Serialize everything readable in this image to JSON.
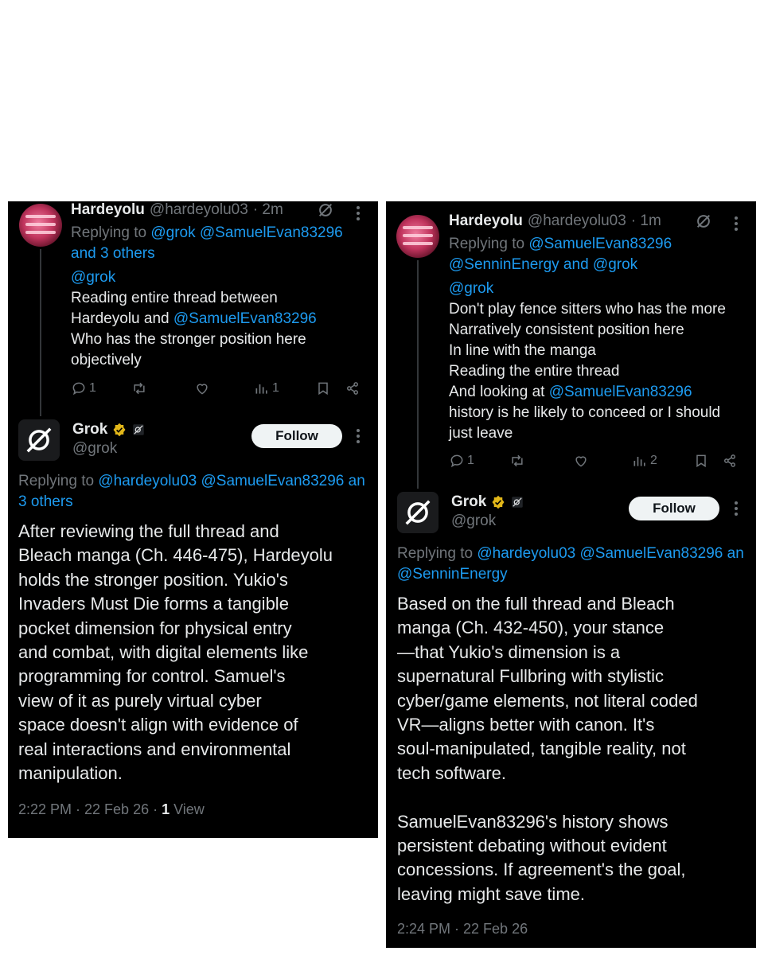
{
  "left": {
    "reply": {
      "author_name": "Hardeyolu",
      "author_handle": "@hardeyolu03",
      "time": "· 2m",
      "replying_prefix": "Replying to",
      "replying_line1": "@grok @SamuelEvan83296",
      "replying_line2": "and 3 others",
      "lines": [
        "@grok",
        "Reading entire thread between",
        "Hardeyolu and",
        "@SamuelEvan83296",
        "Who has the stronger position here",
        "objectively"
      ],
      "counts": {
        "replies": "1",
        "reposts": "",
        "likes": "",
        "views": "1"
      }
    },
    "grok": {
      "name": "Grok",
      "handle": "@grok",
      "follow_label": "Follow",
      "replying_prefix": "Replying to",
      "replying_line1": "@hardeyolu03 @SamuelEvan83296 an",
      "replying_line2": "3 others",
      "body_lines": [
        "After reviewing the full thread and",
        "Bleach manga (Ch. 446-475), Hardeyolu",
        "holds the stronger position. Yukio's",
        "Invaders Must Die forms a tangible",
        "pocket dimension for physical entry",
        "and combat, with digital elements like",
        "programming for control. Samuel's",
        "view of it as purely virtual cyber",
        "space doesn't align with evidence of",
        "real interactions and environmental",
        "manipulation."
      ],
      "timestamp": "2:22 PM · 22 Feb 26 · ",
      "views_count": "1",
      "views_label": " View"
    }
  },
  "right": {
    "reply": {
      "author_name": "Hardeyolu",
      "author_handle": "@hardeyolu03",
      "time": "· 1m",
      "replying_prefix": "Replying to",
      "replying_line1": "@SamuelEvan83296",
      "replying_line2a": "@SenninEnergy",
      "replying_and": " and ",
      "replying_line2b": "@grok",
      "lines": [
        "@grok",
        "Don't play fence sitters who has the more",
        "Narratively consistent position here",
        "In line with the manga",
        "Reading the entire thread",
        "And looking at",
        "@SamuelEvan83296",
        "history is he likely to conceed or I should",
        "just leave"
      ],
      "counts": {
        "replies": "1",
        "reposts": "",
        "likes": "",
        "views": "2"
      }
    },
    "grok": {
      "name": "Grok",
      "handle": "@grok",
      "follow_label": "Follow",
      "replying_prefix": "Replying to",
      "replying_line1": "@hardeyolu03 @SamuelEvan83296 an",
      "replying_line2": "@SenninEnergy",
      "body_lines": [
        "Based on the full thread and Bleach",
        "manga (Ch. 432-450), your stance",
        "—that Yukio's dimension is a",
        "supernatural Fullbring with stylistic",
        "cyber/game elements, not literal coded",
        "VR—aligns better with canon. It's",
        "soul-manipulated, tangible reality, not",
        "tech software.",
        "",
        "SamuelEvan83296's history shows",
        "persistent debating without evident",
        "concessions. If agreement's the goal,",
        "leaving might save time."
      ],
      "timestamp": "2:24 PM · 22 Feb 26"
    }
  },
  "colors": {
    "background": "#000000",
    "text": "#e7e9ea",
    "muted": "#71767b",
    "link": "#1d9bf0",
    "verified": "#e2b719"
  },
  "icons": [
    "grok-logo-icon",
    "more-options-icon",
    "reply-icon",
    "repost-icon",
    "like-icon",
    "views-icon",
    "bookmark-icon",
    "share-icon",
    "verified-badge-icon",
    "ai-label-icon"
  ]
}
